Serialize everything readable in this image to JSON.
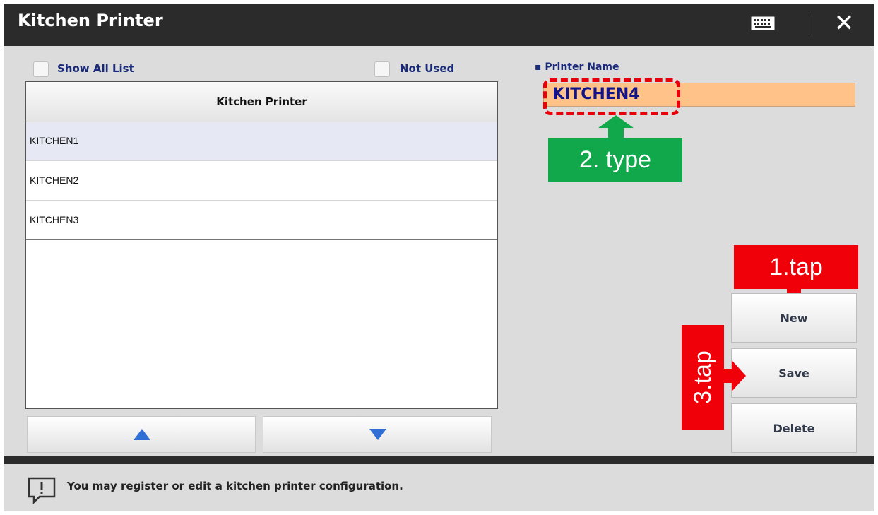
{
  "window": {
    "title": "Kitchen Printer"
  },
  "titlebar_icons": {
    "keyboard": "keyboard-icon",
    "close": "close-icon"
  },
  "filters": {
    "show_all_label": "Show All List",
    "not_used_label": "Not Used"
  },
  "list": {
    "header": "Kitchen Printer",
    "items": [
      {
        "label": "KITCHEN1",
        "selected": true
      },
      {
        "label": "KITCHEN2",
        "selected": false
      },
      {
        "label": "KITCHEN3",
        "selected": false
      }
    ]
  },
  "scroll": {
    "up_icon": "triangle-up-icon",
    "down_icon": "triangle-down-icon"
  },
  "form": {
    "printer_name_label": "Printer Name",
    "printer_name_value": "KITCHEN4"
  },
  "actions": {
    "new_label": "New",
    "save_label": "Save",
    "delete_label": "Delete"
  },
  "annotations": {
    "step1": "1.tap",
    "step2": "2. type",
    "step3": "3.tap"
  },
  "footer": {
    "message": "You may register or edit a kitchen printer configuration."
  },
  "colors": {
    "annotation_red": "#f00008",
    "annotation_green": "#10a84a",
    "input_highlight": "#ffc38a"
  }
}
